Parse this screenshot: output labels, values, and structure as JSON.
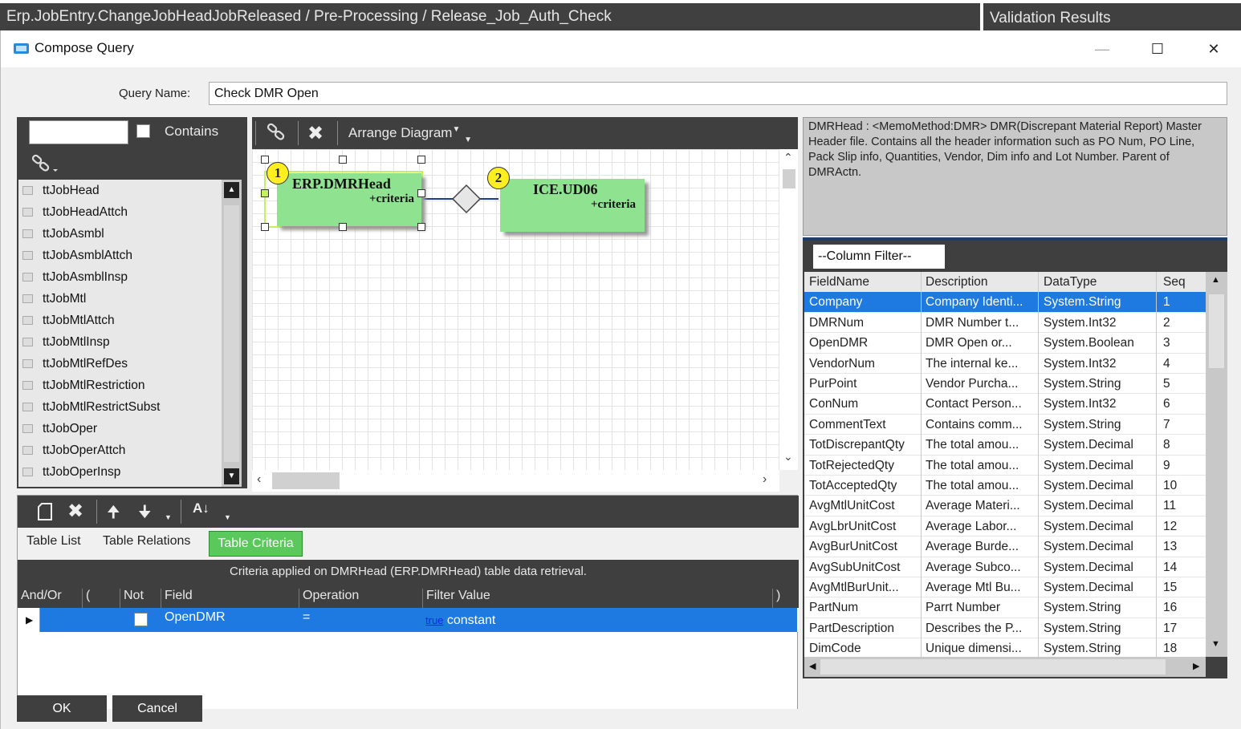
{
  "breadcrumb": "Erp.JobEntry.ChangeJobHeadJobReleased / Pre-Processing / Release_Job_Auth_Check",
  "validation_title": "Validation Results",
  "dialog_title": "Compose Query",
  "query_name_label": "Query Name:",
  "query_name_value": "Check DMR Open",
  "table_search": {
    "placeholder": "",
    "contains_label": "Contains"
  },
  "tables": [
    "ttJobHead",
    "ttJobHeadAttch",
    "ttJobAsmbl",
    "ttJobAsmblAttch",
    "ttJobAsmblInsp",
    "ttJobMtl",
    "ttJobMtlAttch",
    "ttJobMtlInsp",
    "ttJobMtlRefDes",
    "ttJobMtlRestriction",
    "ttJobMtlRestrictSubst",
    "ttJobOper",
    "ttJobOperAttch",
    "ttJobOperInsp"
  ],
  "diagram": {
    "arrange_label": "Arrange Diagram",
    "nodes": [
      {
        "badge": "1",
        "name": "ERP.DMRHead",
        "criteria": "+criteria"
      },
      {
        "badge": "2",
        "name": "ICE.UD06",
        "criteria": "+criteria"
      }
    ]
  },
  "description": "DMRHead : <MemoMethod:DMR>            DMR(Discrepant Material Report) Master Header file.  Contains all the header information such as PO Num, PO Line, Pack Slip info, Quantities, Vendor, Dim info and Lot Number.  Parent of DMRActn.",
  "column_filter": "--Column Filter--",
  "columns": {
    "headers": [
      "FieldName",
      "Description",
      "DataType",
      "Seq"
    ],
    "rows": [
      [
        "Company",
        "Company Identi...",
        "System.String",
        "1"
      ],
      [
        "DMRNum",
        "DMR Number t...",
        "System.Int32",
        "2"
      ],
      [
        "OpenDMR",
        "DMR Open or...",
        "System.Boolean",
        "3"
      ],
      [
        "VendorNum",
        "The internal ke...",
        "System.Int32",
        "4"
      ],
      [
        "PurPoint",
        "Vendor Purcha...",
        "System.String",
        "5"
      ],
      [
        "ConNum",
        "Contact Person...",
        "System.Int32",
        "6"
      ],
      [
        "CommentText",
        "Contains comm...",
        "System.String",
        "7"
      ],
      [
        "TotDiscrepantQty",
        "The total amou...",
        "System.Decimal",
        "8"
      ],
      [
        "TotRejectedQty",
        "The total amou...",
        "System.Decimal",
        "9"
      ],
      [
        "TotAcceptedQty",
        "The total amou...",
        "System.Decimal",
        "10"
      ],
      [
        "AvgMtlUnitCost",
        "Average Materi...",
        "System.Decimal",
        "11"
      ],
      [
        "AvgLbrUnitCost",
        "Average Labor...",
        "System.Decimal",
        "12"
      ],
      [
        "AvgBurUnitCost",
        "Average Burde...",
        "System.Decimal",
        "13"
      ],
      [
        "AvgSubUnitCost",
        "Average Subco...",
        "System.Decimal",
        "14"
      ],
      [
        "AvgMtlBurUnit...",
        "Average Mtl Bu...",
        "System.Decimal",
        "15"
      ],
      [
        "PartNum",
        "Parrt Number",
        "System.String",
        "16"
      ],
      [
        "PartDescription",
        "Describes the P...",
        "System.String",
        "17"
      ],
      [
        "DimCode",
        "Unique dimensi...",
        "System.String",
        "18"
      ]
    ]
  },
  "tabs": {
    "table_list": "Table List",
    "table_relations": "Table Relations",
    "table_criteria": "Table Criteria"
  },
  "criteria": {
    "caption": "Criteria applied on DMRHead (ERP.DMRHead)  table data retrieval.",
    "headers": {
      "and_or": "And/Or",
      "lparen": "(",
      "not": "Not",
      "field": "Field",
      "operation": "Operation",
      "filter_value": "Filter Value",
      "rparen": ")"
    },
    "row": {
      "field": "OpenDMR",
      "operation": "=",
      "value_link": "true",
      "value_type": "constant"
    }
  },
  "buttons": {
    "ok": "OK",
    "cancel": "Cancel"
  }
}
